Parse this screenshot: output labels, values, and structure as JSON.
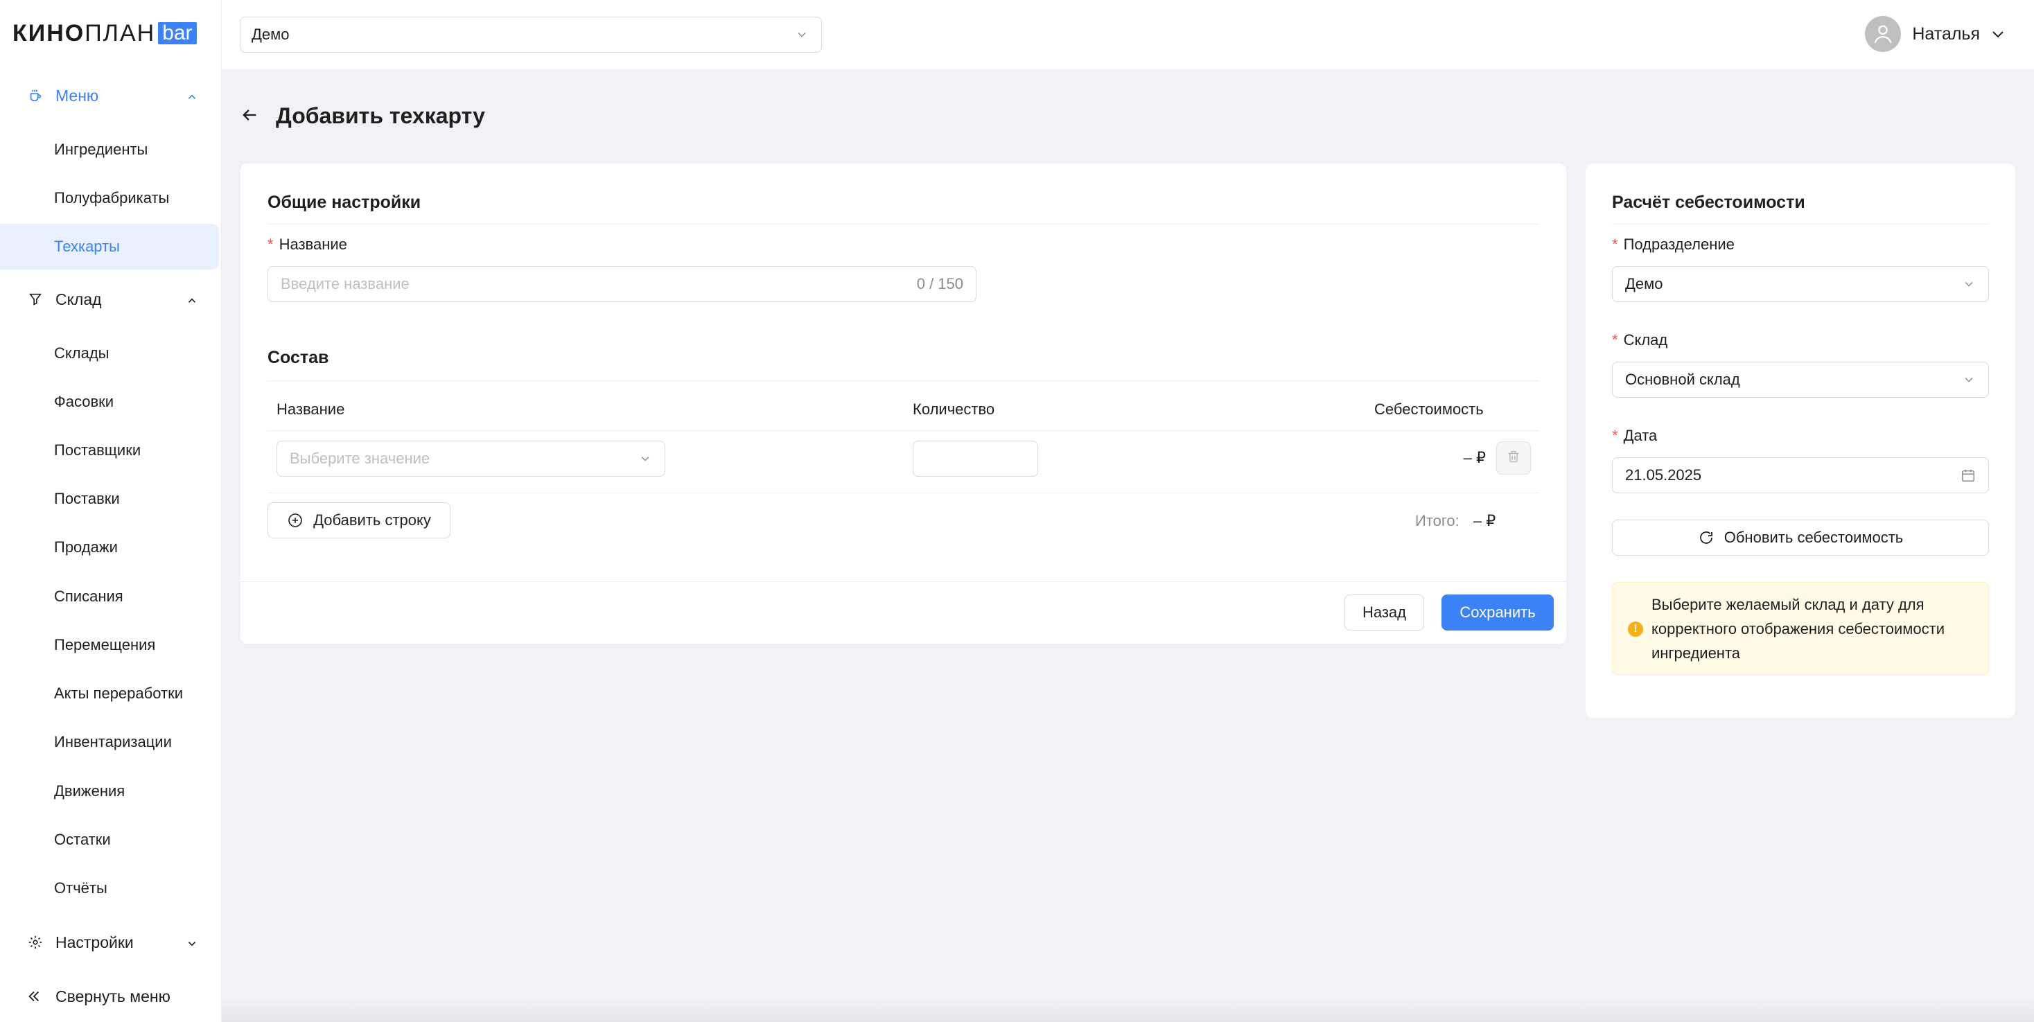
{
  "logo": {
    "part1": "КИНО",
    "part2": "ПЛАН",
    "badge": "bar"
  },
  "header": {
    "organization": "Демо",
    "user_name": "Наталья"
  },
  "sidebar": {
    "groups": [
      {
        "label": "Меню",
        "icon": "cup-icon",
        "expanded": true
      },
      {
        "label": "Склад",
        "icon": "funnel-icon",
        "expanded": true
      },
      {
        "label": "Настройки",
        "icon": "gear-icon",
        "expanded": false
      }
    ],
    "menu_items": [
      "Ингредиенты",
      "Полуфабрикаты",
      "Техкарты"
    ],
    "warehouse_items": [
      "Склады",
      "Фасовки",
      "Поставщики",
      "Поставки",
      "Продажи",
      "Списания",
      "Перемещения",
      "Акты переработки",
      "Инвентаризации",
      "Движения",
      "Остатки",
      "Отчёты"
    ],
    "selected": "Техкарты",
    "collapse_label": "Свернуть меню"
  },
  "page": {
    "title": "Добавить техкарту"
  },
  "general": {
    "title": "Общие настройки",
    "name_label": "Название",
    "name_placeholder": "Введите название",
    "name_counter": "0 / 150"
  },
  "composition": {
    "title": "Состав",
    "columns": {
      "name": "Название",
      "quantity": "Количество",
      "cost": "Себестоимость"
    },
    "row": {
      "name_placeholder": "Выберите значение",
      "quantity": "",
      "cost": "– ₽"
    },
    "add_row_label": "Добавить строку",
    "total_label": "Итого:",
    "total_value": "– ₽"
  },
  "actions": {
    "back_label": "Назад",
    "save_label": "Сохранить"
  },
  "cost_calc": {
    "title": "Расчёт себестоимости",
    "division_label": "Подразделение",
    "division_value": "Демо",
    "warehouse_label": "Склад",
    "warehouse_value": "Основной склад",
    "date_label": "Дата",
    "date_value": "21.05.2025",
    "refresh_label": "Обновить себестоимость",
    "notice": "Выберите желаемый склад и дату для корректного отображения себестоимости ингредиента"
  },
  "colors": {
    "accent": "#3b82f6",
    "required": "#ff4d4f",
    "warning": "#faad14",
    "notice_bg": "#fffbe6"
  }
}
